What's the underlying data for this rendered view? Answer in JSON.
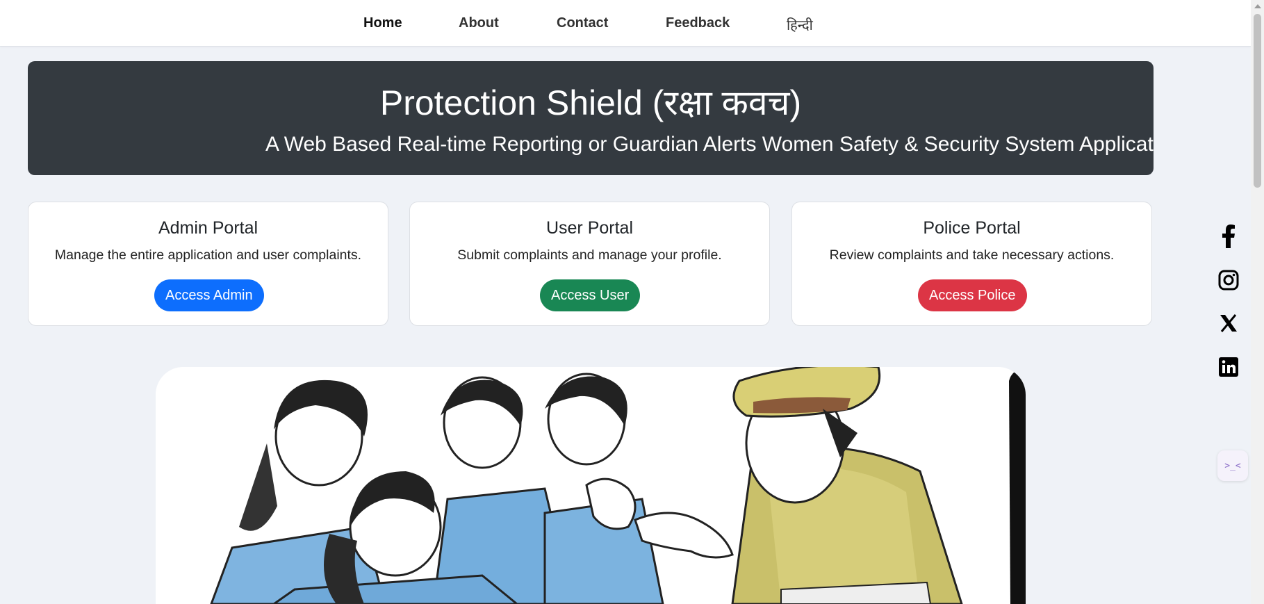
{
  "nav": {
    "items": [
      {
        "label": "Home",
        "active": true
      },
      {
        "label": "About",
        "active": false
      },
      {
        "label": "Contact",
        "active": false
      },
      {
        "label": "Feedback",
        "active": false
      },
      {
        "label": "हिन्दी",
        "active": false
      }
    ]
  },
  "hero": {
    "title": "Protection Shield (रक्षा कवच)",
    "subtitle": "A Web Based Real-time Reporting or Guardian Alerts Women Safety & Security System Application"
  },
  "portals": [
    {
      "title": "Admin Portal",
      "description": "Manage the entire application and user complaints.",
      "button": "Access Admin",
      "color": "#0d6efd"
    },
    {
      "title": "User Portal",
      "description": "Submit complaints and manage your profile.",
      "button": "Access User",
      "color": "#198754"
    },
    {
      "title": "Police Portal",
      "description": "Review complaints and take necessary actions.",
      "button": "Access Police",
      "color": "#dc3545"
    }
  ],
  "social": [
    "facebook-icon",
    "instagram-icon",
    "x-icon",
    "linkedin-icon"
  ],
  "widget": {
    "label": ">_<"
  }
}
